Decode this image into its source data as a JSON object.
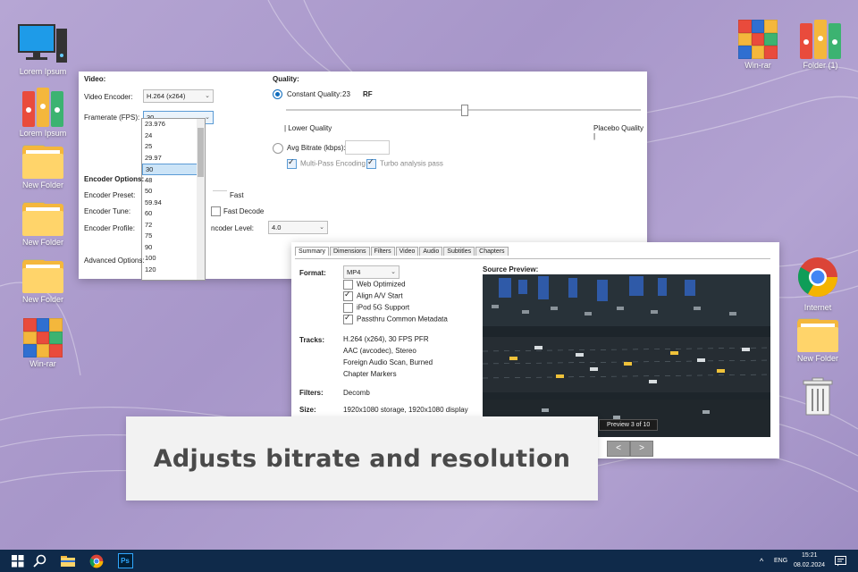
{
  "desktop": {
    "left_icons": [
      {
        "label": "Lorem Ipsum",
        "icon": "computer-icon"
      },
      {
        "label": "Lorem Ipsum",
        "icon": "binders-icon"
      },
      {
        "label": "New Folder",
        "icon": "folder-icon"
      },
      {
        "label": "New Folder",
        "icon": "folder-icon"
      },
      {
        "label": "New Folder",
        "icon": "folder-icon"
      },
      {
        "label": "Win-rar",
        "icon": "winrar-icon"
      }
    ],
    "right_icons": [
      {
        "label": "Win-rar",
        "icon": "winrar-icon"
      },
      {
        "label": "Folder (1)",
        "icon": "binders-icon"
      },
      {
        "label": "Internet",
        "icon": "chrome-icon"
      },
      {
        "label": "New Folder",
        "icon": "folder-icon"
      },
      {
        "label": "",
        "icon": "trash-icon"
      }
    ]
  },
  "video_window": {
    "video_heading": "Video:",
    "encoder_label": "Video Encoder:",
    "encoder_value": "H.264 (x264)",
    "framerate_label": "Framerate (FPS):",
    "framerate_value": "30",
    "framerate_options": [
      "23.976",
      "24",
      "25",
      "29.97",
      "30",
      "48",
      "50",
      "59.94",
      "60",
      "72",
      "75",
      "90",
      "100",
      "120"
    ],
    "framerate_selected": "30",
    "encoder_options_heading": "Encoder Options:",
    "preset_label": "Encoder Preset:",
    "preset_right": "Fast",
    "tune_label": "Encoder Tune:",
    "fast_decode_label": "Fast Decode",
    "profile_label": "Encoder Profile:",
    "level_label": "ncoder Level:",
    "level_value": "4.0",
    "advanced_label": "Advanced Options:",
    "quality_heading": "Quality:",
    "constant_quality_label": "Constant Quality:",
    "constant_quality_value": "23",
    "rf_label": "RF",
    "slider_position": 0.5,
    "lower_quality": "| Lower Quality",
    "placebo_quality": "Placebo Quality |",
    "avg_bitrate_label": "Avg Bitrate (kbps):",
    "multipass_label": "Multi-Pass Encoding",
    "turbo_label": "Turbo analysis pass"
  },
  "summary_window": {
    "tabs": [
      "Summary",
      "Dimensions",
      "Filters",
      "Video",
      "Audio",
      "Subtitles",
      "Chapters"
    ],
    "active_tab": "Summary",
    "format_label": "Format:",
    "format_value": "MP4",
    "checks": [
      {
        "label": "Web Optimized",
        "checked": false
      },
      {
        "label": "Align A/V Start",
        "checked": true
      },
      {
        "label": "iPod 5G Support",
        "checked": false
      },
      {
        "label": "Passthru Common Metadata",
        "checked": true
      }
    ],
    "tracks_label": "Tracks:",
    "tracks": [
      "H.264 (x264), 30 FPS PFR",
      "AAC (avcodec), Stereo",
      "Foreign Audio Scan, Burned",
      "Chapter Markers"
    ],
    "filters_label": "Filters:",
    "filters_value": "Decomb",
    "size_label": "Size:",
    "size_value": "1920x1080 storage, 1920x1080 display",
    "source_preview_label": "Source Preview:",
    "preview_badge": "Preview 3 of 10",
    "prev_btn": "<",
    "next_btn": ">"
  },
  "caption": "Adjusts bitrate and resolution",
  "taskbar": {
    "lang": "ENG",
    "time": "15:21",
    "date": "08.02.2024",
    "caret": "^",
    "ps_label": "Ps"
  },
  "colors": {
    "accent": "#0f6cbd",
    "taskbar": "#0f2a4a",
    "folder": "#f4b73c"
  }
}
